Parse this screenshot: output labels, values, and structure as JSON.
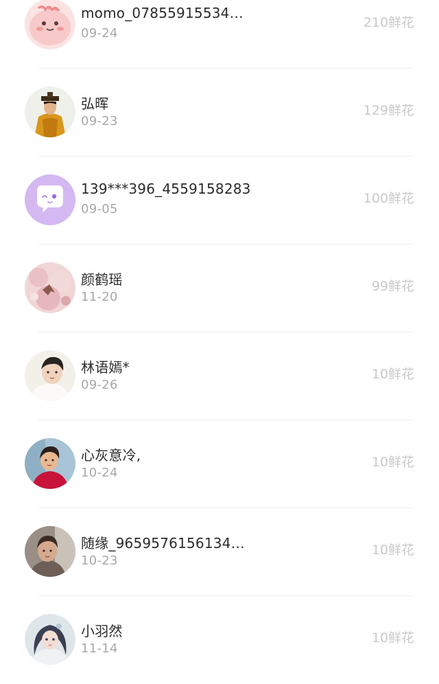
{
  "gift_list": {
    "items": [
      {
        "avatar": "cute-pink-blob-avatar",
        "name": "momo_07855915534…",
        "date": "09-24",
        "amount": "210鲜花"
      },
      {
        "avatar": "costume-figure-avatar",
        "name": "弘晖",
        "date": "09-23",
        "amount": "129鲜花"
      },
      {
        "avatar": "purple-chat-bubble-avatar",
        "name": "139***396_4559158283",
        "date": "09-05",
        "amount": "100鲜花"
      },
      {
        "avatar": "pink-blossom-avatar",
        "name": "颜鹤瑶",
        "date": "11-20",
        "amount": "99鲜花"
      },
      {
        "avatar": "child-photo-avatar",
        "name": "林语嫣*",
        "date": "09-26",
        "amount": "10鲜花"
      },
      {
        "avatar": "girl-red-shirt-avatar",
        "name": "心灰意冷,",
        "date": "10-24",
        "amount": "10鲜花"
      },
      {
        "avatar": "person-photo-avatar",
        "name": "随缘_9659576156134…",
        "date": "10-23",
        "amount": "10鲜花"
      },
      {
        "avatar": "anime-girl-avatar",
        "name": "小羽然",
        "date": "11-14",
        "amount": "10鲜花"
      }
    ]
  },
  "colors": {
    "name_text": "#2b2b2b",
    "date_text": "#a8a8a8",
    "amount_text": "#c9c9c9",
    "divider": "#f0f0f0"
  }
}
